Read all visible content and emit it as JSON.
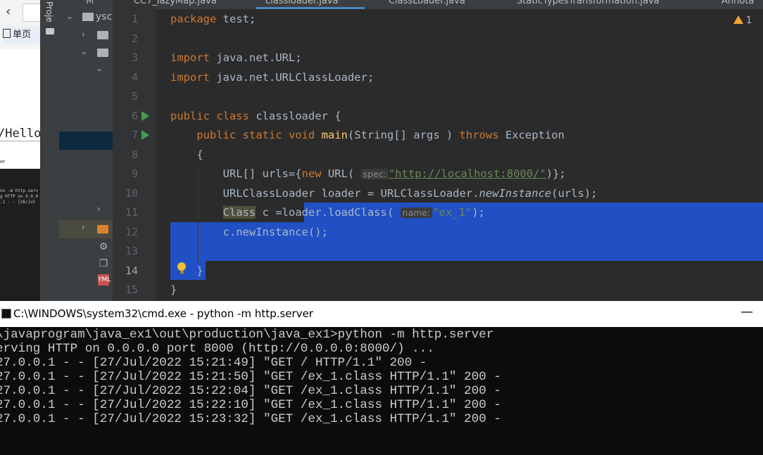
{
  "browser": {
    "back_icon": "chevron-left-icon",
    "bookmark_label": "单页",
    "page_text": "/Hello",
    "mini_terminal": {
      "header": "er",
      "lines": [
        "",
        "on -m http.serv",
        "g HTTP on 0.0.0",
        ".1 - - [26/Jul"
      ]
    }
  },
  "toolstrip": {
    "label": "Proje"
  },
  "project_tree": {
    "root_label": "ysc"
  },
  "editor": {
    "tabs": [
      "M",
      "CC7_lazyMap.java",
      "classloader.java",
      "ClassLoader.java",
      "StaticTypesTransformation.java",
      "Annota"
    ],
    "active_tab": "classloader.java",
    "warning_count": "1",
    "line_numbers": [
      "1",
      "2",
      "3",
      "4",
      "5",
      "6",
      "7",
      "8",
      "9",
      "10",
      "11",
      "12",
      "13",
      "14",
      "15"
    ],
    "current_line": "14",
    "code": {
      "l1_kw": "package",
      "l1_rest": " test;",
      "l3_kw": "import",
      "l3_rest": " java.net.URL;",
      "l4_kw": "import",
      "l4_rest": " java.net.URLClassLoader;",
      "l6_kw1": "public",
      "l6_kw2": "class",
      "l6_rest": " classloader {",
      "l7_kw1": "public",
      "l7_kw2": "static",
      "l7_kw3": "void",
      "l7_fn": "main",
      "l7_mid": "(String[] args ) ",
      "l7_kw4": "throws",
      "l7_end": " Exception",
      "l8": "{",
      "l9_a": "URL[] urls={",
      "l9_kw": "new",
      "l9_b": " URL(",
      "l9_hint": "spec:",
      "l9_str": "\"http://localhost:8000/\"",
      "l9_c": ")};",
      "l10_a": "URLClassLoader loader = URLClassLoader.",
      "l10_it": "newInstance",
      "l10_b": "(urls);",
      "l11_cls": "Class",
      "l11_a": " c =lo",
      "l11_b": "ader.loadClass(",
      "l11_hint": "name:",
      "l11_str": "\"ex_1\"",
      "l11_c": ");",
      "l12": "c.newInstance();",
      "l14": "}",
      "l15": "}"
    }
  },
  "cmd": {
    "title": "C:\\WINDOWS\\system32\\cmd.exe - python  -m http.server",
    "minimize_glyph": "—",
    "lines": [
      "\\javaprogram\\java_ex1\\out\\production\\java_ex1>python -m http.server",
      "erving HTTP on 0.0.0.0 port 8000 (http://0.0.0.0:8000/) ...",
      "27.0.0.1 - - [27/Jul/2022 15:21:49] \"GET / HTTP/1.1\" 200 -",
      "27.0.0.1 - - [27/Jul/2022 15:21:50] \"GET /ex_1.class HTTP/1.1\" 200 -",
      "27.0.0.1 - - [27/Jul/2022 15:22:04] \"GET /ex_1.class HTTP/1.1\" 200 -",
      "27.0.0.1 - - [27/Jul/2022 15:22:10] \"GET /ex_1.class HTTP/1.1\" 200 -",
      "27.0.0.1 - - [27/Jul/2022 15:23:32] \"GET /ex_1.class HTTP/1.1\" 200 -"
    ]
  },
  "colors": {
    "editor_bg": "#2b2b2b",
    "keyword": "#cc7832",
    "function": "#ffc66d",
    "string": "#6a8759",
    "selection": "#2150c4",
    "cmd_bg": "#0c0c0c"
  }
}
